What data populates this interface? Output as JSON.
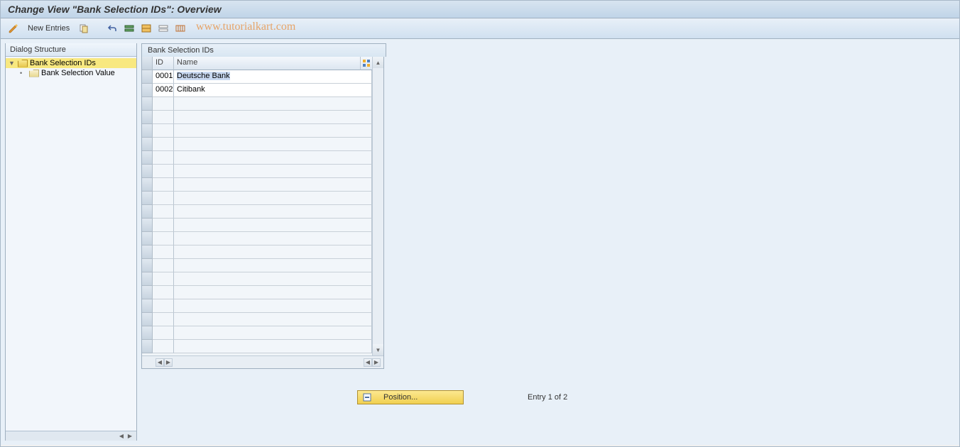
{
  "header": {
    "title": "Change View \"Bank Selection IDs\": Overview"
  },
  "toolbar": {
    "new_entries": "New Entries"
  },
  "watermark": "www.tutorialkart.com",
  "sidebar": {
    "header": "Dialog Structure",
    "items": [
      {
        "label": "Bank Selection IDs",
        "selected": true,
        "open": true
      },
      {
        "label": "Bank Selection Value",
        "selected": false,
        "open": false
      }
    ]
  },
  "table": {
    "title": "Bank Selection IDs",
    "columns": {
      "id": "ID",
      "name": "Name"
    },
    "rows": [
      {
        "id": "0001",
        "name": "Deutsche Bank",
        "selected": true
      },
      {
        "id": "0002",
        "name": "Citibank",
        "selected": false
      }
    ]
  },
  "footer": {
    "position_label": "Position...",
    "entry_text": "Entry 1 of 2"
  }
}
